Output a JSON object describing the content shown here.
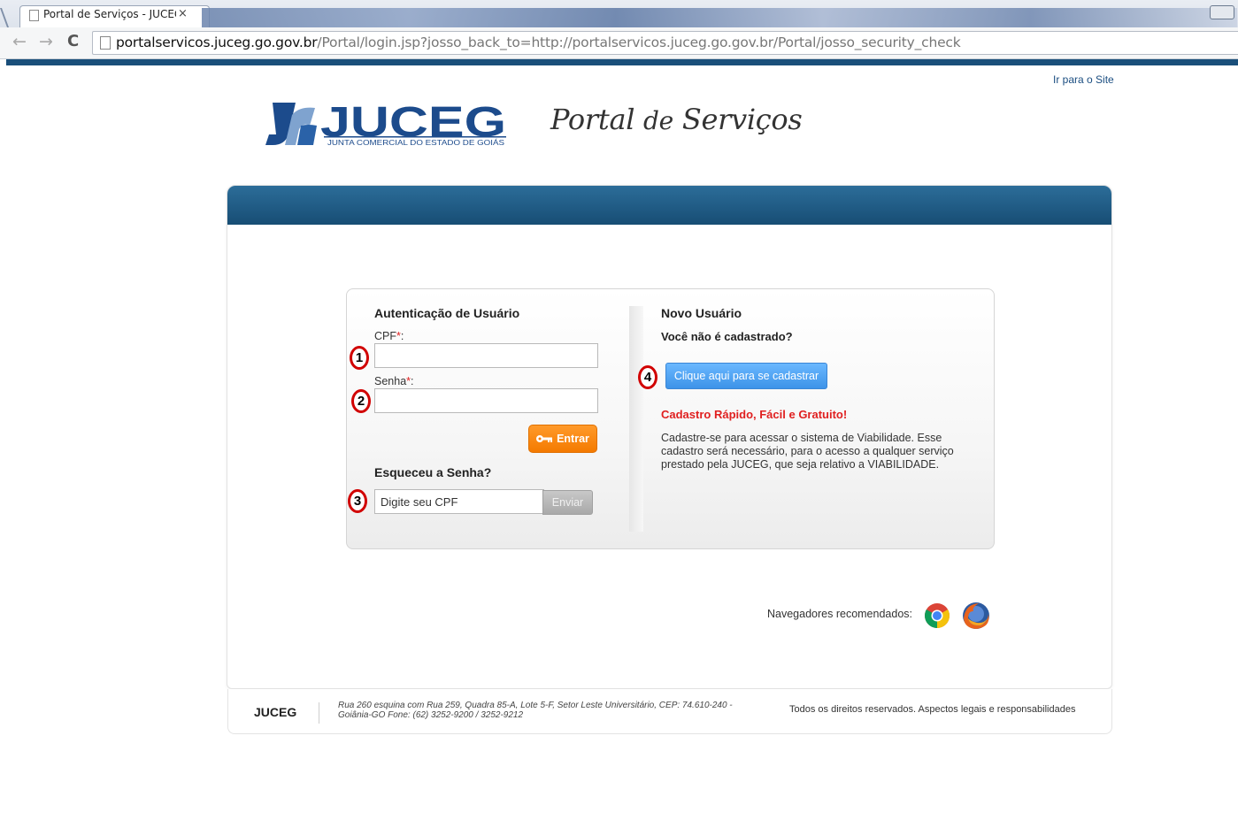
{
  "browser": {
    "tab_title": "Portal de Serviços - JUCEG",
    "tab_close": "×",
    "url_host": "portalservicos.juceg.go.gov.br",
    "url_path": "/Portal/login.jsp?josso_back_to=http://portalservicos.juceg.go.gov.br/Portal/josso_security_check"
  },
  "header": {
    "site_link": "Ir para o Site",
    "logo_text": "JUCEG",
    "logo_subtitle": "JUNTA COMERCIAL DO ESTADO DE GOIÁS",
    "portal_title_a": "Portal ",
    "portal_title_de": "de",
    "portal_title_b": " Serviços"
  },
  "login": {
    "heading": "Autenticação de Usuário",
    "cpf_label": "CPF",
    "senha_label": "Senha",
    "required_mark": "*",
    "colon": ":",
    "enter_label": "Entrar",
    "forgot_heading": "Esqueceu a Senha?",
    "forgot_value": "Digite seu CPF",
    "send_label": "Enviar"
  },
  "signup": {
    "heading": "Novo Usuário",
    "question": "Você não é cadastrado?",
    "button_label": "Clique aqui para se cadastrar",
    "tagline": "Cadastro Rápido, Fácil e Gratuito!",
    "description": "Cadastre-se para acessar o sistema de Viabilidade. Esse cadastro será necessário, para o acesso a qualquer serviço prestado pela JUCEG, que seja relativo a VIABILIDADE."
  },
  "annotations": [
    "1",
    "2",
    "3",
    "4"
  ],
  "browsers_recommended": "Navegadores recomendados:",
  "footer": {
    "brand": "JUCEG",
    "address": "Rua 260 esquina com Rua 259, Quadra 85-A, Lote 5-F, Setor Leste Universitário, CEP: 74.610-240 - Goiânia-GO Fone: (62) 3252-9200 / 3252-9212",
    "rights": "Todos os direitos reservados. Aspectos legais e responsabilidades"
  },
  "colors": {
    "brand_blue": "#1a4f7a",
    "orange_button": "#f47a00",
    "blue_button": "#3d93e8",
    "required_red": "#e02020"
  },
  "icons": [
    "page-icon",
    "back-arrow-icon",
    "forward-arrow-icon",
    "reload-icon",
    "key-icon",
    "chrome-icon",
    "firefox-icon"
  ]
}
